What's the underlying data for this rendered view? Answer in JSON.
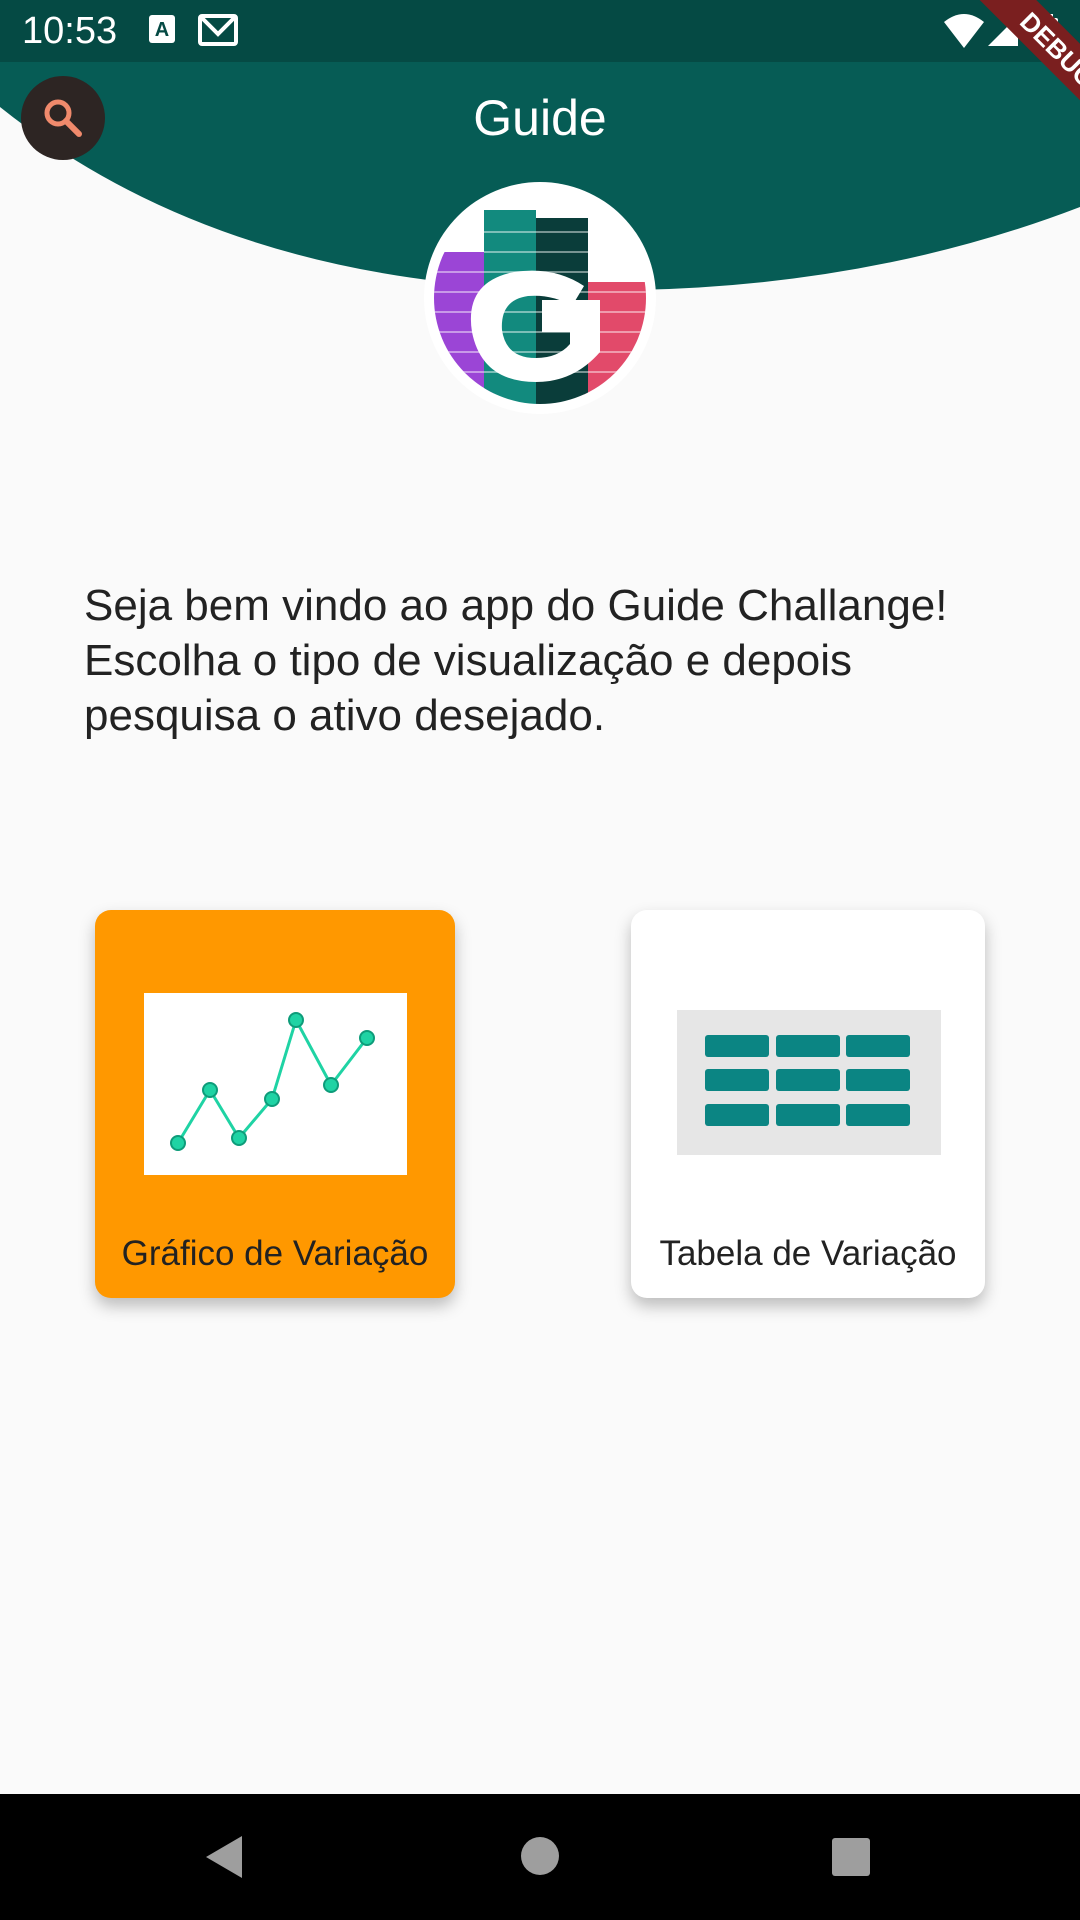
{
  "status_bar": {
    "time": "10:53",
    "icons": [
      "keyboard-a-icon",
      "gmail-icon",
      "wifi-icon",
      "signal-icon",
      "battery-icon"
    ]
  },
  "debug_banner": "DEBUG",
  "header": {
    "title": "Guide",
    "search_icon": "search-icon",
    "background_color": "#065c55"
  },
  "welcome_text": "Seja bem vindo ao app do Guide Challange! Escolha o tipo de visualização e depois pesquisa o ativo desejado.",
  "cards": {
    "chart": {
      "label": "Gráfico de Variação",
      "color": "#ff9800",
      "icon": "line-chart-icon"
    },
    "table": {
      "label": "Tabela de Variação",
      "color": "#ffffff",
      "icon": "table-grid-icon"
    }
  },
  "nav": {
    "back": "back-triangle-icon",
    "home": "home-circle-icon",
    "recents": "recents-square-icon"
  }
}
